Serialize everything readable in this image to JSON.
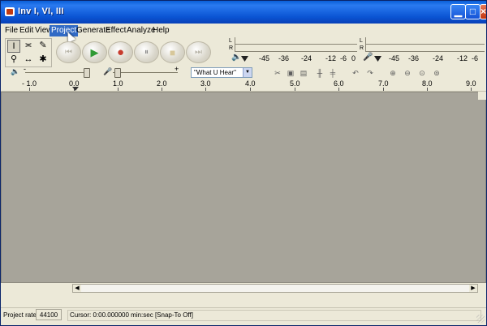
{
  "window": {
    "title": "Inv I, VI, III"
  },
  "menu": {
    "items": [
      {
        "label": "File"
      },
      {
        "label": "Edit"
      },
      {
        "label": "View"
      },
      {
        "label": "Project"
      },
      {
        "label": "Generate"
      },
      {
        "label": "Effect"
      },
      {
        "label": "Analyze"
      },
      {
        "label": "Help"
      }
    ],
    "active": "Project"
  },
  "tools": [
    {
      "name": "selection-tool",
      "glyph": "I"
    },
    {
      "name": "envelope-tool",
      "glyph": "≍"
    },
    {
      "name": "draw-tool",
      "glyph": "✎"
    },
    {
      "name": "zoom-tool",
      "glyph": "⚲"
    },
    {
      "name": "timeshift-tool",
      "glyph": "↔"
    },
    {
      "name": "multi-tool",
      "glyph": "✱"
    }
  ],
  "transport": {
    "skip_start": "⏮",
    "play": "▶",
    "record": "●",
    "pause": "⏸",
    "stop": "■",
    "skip_end": "⏭"
  },
  "meters": {
    "left_label": "L",
    "right_label": "R",
    "scale": [
      "-45",
      "-36",
      "-24",
      "-12",
      "-6",
      "0"
    ]
  },
  "mixer": {
    "input_source": "\"What U Hear\"",
    "output_minus": "-",
    "output_plus": "+"
  },
  "ruler": {
    "labels": [
      "- 1.0",
      "0.0",
      "1.0",
      "2.0",
      "3.0",
      "4.0",
      "5.0",
      "6.0",
      "7.0",
      "8.0",
      "9.0"
    ]
  },
  "status": {
    "project_rate_label": "Project rate:",
    "project_rate_value": "44100",
    "cursor_text": "Cursor: 0:00.000000 min:sec  [Snap-To Off]"
  },
  "colors": {
    "titlebar": "#0b55d4",
    "chrome": "#ece9d8",
    "track_area": "#a7a49a",
    "menu_highlight": "#316ac5",
    "record": "#c73c2e",
    "play": "#2f9a35"
  }
}
